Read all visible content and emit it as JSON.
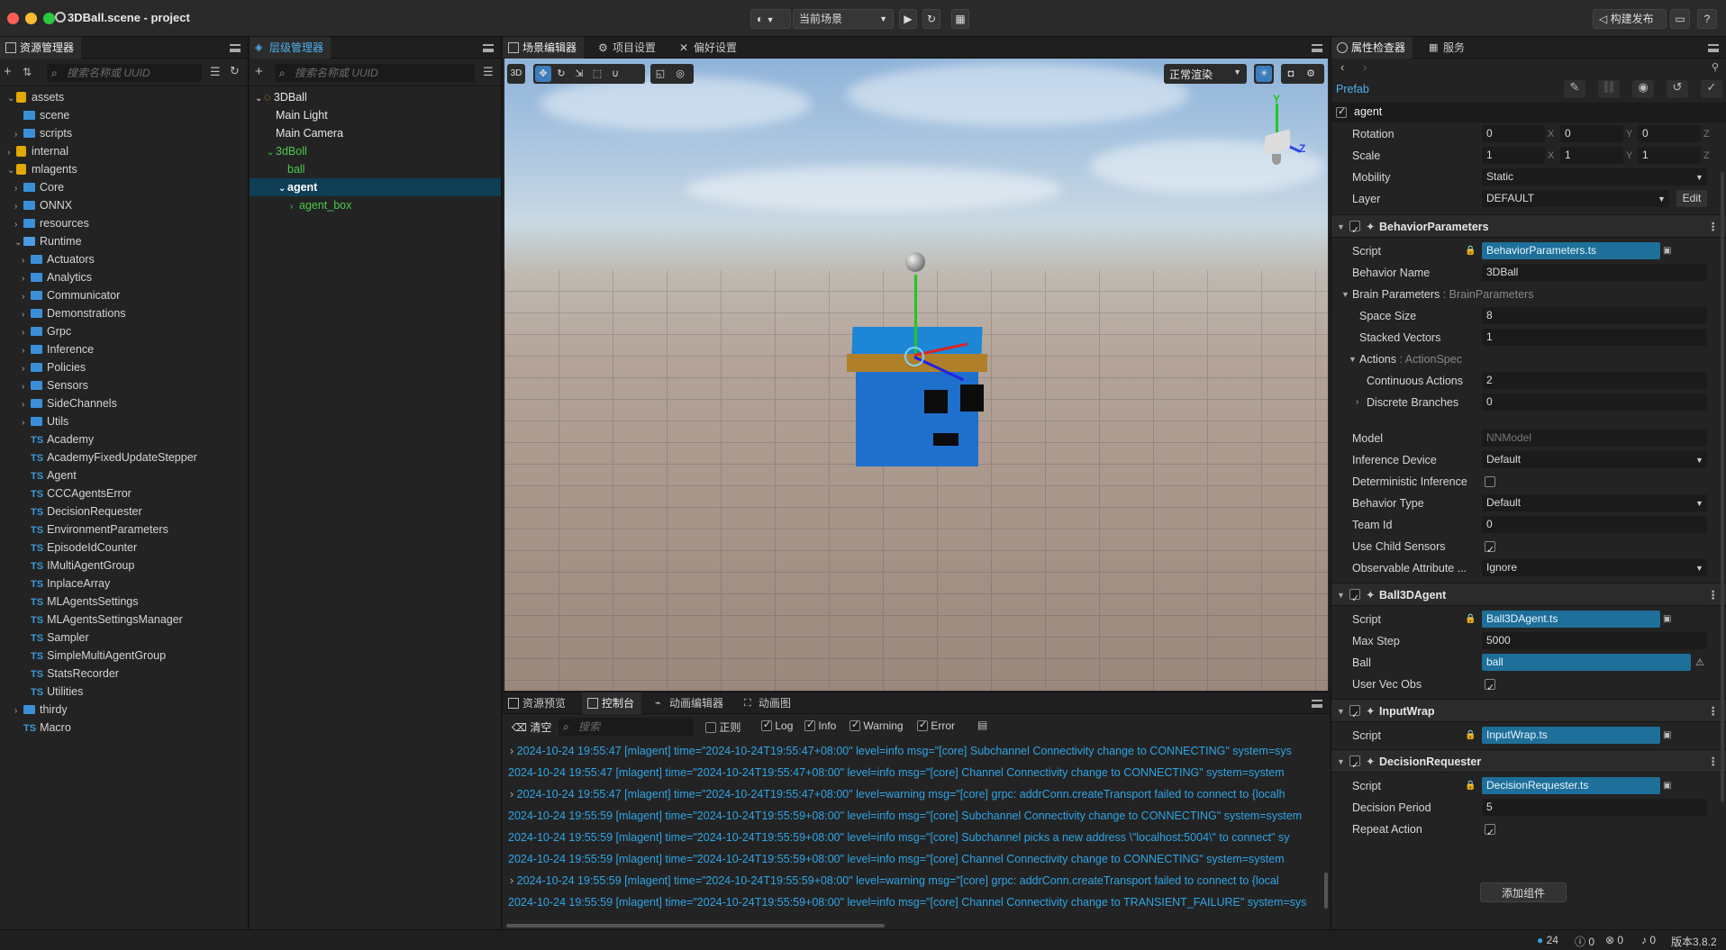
{
  "window": {
    "title": "3DBall.scene - project",
    "scene_selector": "当前场景",
    "build_button": "构建发布"
  },
  "assets_panel": {
    "tab": "资源管理器",
    "search_placeholder": "搜索名称或 UUID",
    "items": [
      {
        "label": "assets",
        "type": "db",
        "depth": 0,
        "expanded": true
      },
      {
        "label": "scene",
        "type": "folder",
        "depth": 1
      },
      {
        "label": "scripts",
        "type": "folder",
        "depth": 1,
        "collapsed": true
      },
      {
        "label": "internal",
        "type": "db",
        "depth": 0,
        "collapsed": true
      },
      {
        "label": "mlagents",
        "type": "db",
        "depth": 0,
        "expanded": true
      },
      {
        "label": "Core",
        "type": "folder",
        "depth": 1,
        "collapsed": true
      },
      {
        "label": "ONNX",
        "type": "folder",
        "depth": 1,
        "collapsed": true
      },
      {
        "label": "resources",
        "type": "folder",
        "depth": 1,
        "collapsed": true
      },
      {
        "label": "Runtime",
        "type": "folder",
        "depth": 1,
        "expanded": true
      },
      {
        "label": "Actuators",
        "type": "folder",
        "depth": 2,
        "collapsed": true
      },
      {
        "label": "Analytics",
        "type": "folder",
        "depth": 2,
        "collapsed": true
      },
      {
        "label": "Communicator",
        "type": "folder",
        "depth": 2,
        "collapsed": true
      },
      {
        "label": "Demonstrations",
        "type": "folder",
        "depth": 2,
        "collapsed": true
      },
      {
        "label": "Grpc",
        "type": "folder",
        "depth": 2,
        "collapsed": true
      },
      {
        "label": "Inference",
        "type": "folder",
        "depth": 2,
        "collapsed": true
      },
      {
        "label": "Policies",
        "type": "folder",
        "depth": 2,
        "collapsed": true
      },
      {
        "label": "Sensors",
        "type": "folder",
        "depth": 2,
        "collapsed": true
      },
      {
        "label": "SideChannels",
        "type": "folder",
        "depth": 2,
        "collapsed": true
      },
      {
        "label": "Utils",
        "type": "folder",
        "depth": 2,
        "collapsed": true
      },
      {
        "label": "Academy",
        "type": "ts",
        "depth": 2
      },
      {
        "label": "AcademyFixedUpdateStepper",
        "type": "ts",
        "depth": 2
      },
      {
        "label": "Agent",
        "type": "ts",
        "depth": 2
      },
      {
        "label": "CCCAgentsError",
        "type": "ts",
        "depth": 2
      },
      {
        "label": "DecisionRequester",
        "type": "ts",
        "depth": 2
      },
      {
        "label": "EnvironmentParameters",
        "type": "ts",
        "depth": 2
      },
      {
        "label": "EpisodeIdCounter",
        "type": "ts",
        "depth": 2
      },
      {
        "label": "IMultiAgentGroup",
        "type": "ts",
        "depth": 2
      },
      {
        "label": "InplaceArray",
        "type": "ts",
        "depth": 2
      },
      {
        "label": "MLAgentsSettings",
        "type": "ts",
        "depth": 2
      },
      {
        "label": "MLAgentsSettingsManager",
        "type": "ts",
        "depth": 2
      },
      {
        "label": "Sampler",
        "type": "ts",
        "depth": 2
      },
      {
        "label": "SimpleMultiAgentGroup",
        "type": "ts",
        "depth": 2
      },
      {
        "label": "StatsRecorder",
        "type": "ts",
        "depth": 2
      },
      {
        "label": "Utilities",
        "type": "ts",
        "depth": 2
      },
      {
        "label": "thirdy",
        "type": "folder",
        "depth": 1,
        "collapsed": true
      },
      {
        "label": "Macro",
        "type": "ts",
        "depth": 1
      }
    ]
  },
  "hierarchy_panel": {
    "tab": "层级管理器",
    "search_placeholder": "搜索名称或 UUID",
    "items": [
      {
        "label": "3DBall",
        "depth": 0,
        "color": "#e6e6e6",
        "arrow": "v",
        "icon": "scene"
      },
      {
        "label": "Main Light",
        "depth": 1,
        "color": "#e6e6e6"
      },
      {
        "label": "Main Camera",
        "depth": 1,
        "color": "#e6e6e6"
      },
      {
        "label": "3dBoll",
        "depth": 1,
        "color": "#4cc94c",
        "arrow": "v"
      },
      {
        "label": "ball",
        "depth": 2,
        "color": "#4cc94c"
      },
      {
        "label": "agent",
        "depth": 2,
        "color": "#ffffff",
        "arrow": "v",
        "selected": true
      },
      {
        "label": "agent_box",
        "depth": 3,
        "color": "#4cc94c",
        "arrow": ">"
      }
    ]
  },
  "center_tabs": {
    "scene_editor": "场景编辑器",
    "project_settings": "项目设置",
    "preferences": "偏好设置",
    "render_mode": "正常渲染",
    "mode_3d": "3D"
  },
  "bottom_tabs": {
    "asset_preview": "资源预览",
    "console": "控制台",
    "animation_editor": "动画编辑器",
    "animation_graph": "动画图"
  },
  "console": {
    "clear": "清空",
    "search_placeholder": "搜索",
    "filters": {
      "regex": "正则",
      "log": "Log",
      "info": "Info",
      "warning": "Warning",
      "error": "Error"
    },
    "lines": [
      {
        "text": "2024-10-24 19:55:47 [mlagent] time=\"2024-10-24T19:55:47+08:00\" level=info msg=\"[core] Subchannel Connectivity change to CONNECTING\" system=sys",
        "expand": true
      },
      {
        "text": "2024-10-24 19:55:47 [mlagent] time=\"2024-10-24T19:55:47+08:00\" level=info msg=\"[core] Channel Connectivity change to CONNECTING\" system=system",
        "expand": false
      },
      {
        "text": "2024-10-24 19:55:47 [mlagent] time=\"2024-10-24T19:55:47+08:00\" level=warning msg=\"[core] grpc: addrConn.createTransport failed to connect to {localh",
        "expand": true
      },
      {
        "text": "2024-10-24 19:55:59 [mlagent] time=\"2024-10-24T19:55:59+08:00\" level=info msg=\"[core] Subchannel Connectivity change to CONNECTING\" system=system",
        "expand": false
      },
      {
        "text": "2024-10-24 19:55:59 [mlagent] time=\"2024-10-24T19:55:59+08:00\" level=info msg=\"[core] Subchannel picks a new address \\\"localhost:5004\\\" to connect\" sy",
        "expand": false
      },
      {
        "text": "2024-10-24 19:55:59 [mlagent] time=\"2024-10-24T19:55:59+08:00\" level=info msg=\"[core] Channel Connectivity change to CONNECTING\" system=system",
        "expand": false
      },
      {
        "text": "2024-10-24 19:55:59 [mlagent] time=\"2024-10-24T19:55:59+08:00\" level=warning msg=\"[core] grpc: addrConn.createTransport failed to connect to {local",
        "expand": true
      },
      {
        "text": "2024-10-24 19:55:59 [mlagent] time=\"2024-10-24T19:55:59+08:00\" level=info msg=\"[core] Channel Connectivity change to TRANSIENT_FAILURE\" system=sys",
        "expand": false
      }
    ]
  },
  "inspector": {
    "tab": "属性检查器",
    "services_tab": "服务",
    "prefab_label": "Prefab",
    "node_name": "agent",
    "transform": {
      "rotation_label": "Rotation",
      "rotation": [
        "0",
        "0",
        "0"
      ],
      "scale_label": "Scale",
      "scale": [
        "1",
        "1",
        "1"
      ],
      "axes": [
        "X",
        "Y",
        "Z"
      ],
      "mobility_label": "Mobility",
      "mobility": "Static",
      "layer_label": "Layer",
      "layer": "DEFAULT",
      "edit": "Edit"
    },
    "behavior_parameters": {
      "title": "BehaviorParameters",
      "script_label": "Script",
      "script": "BehaviorParameters.ts",
      "behavior_name_label": "Behavior Name",
      "behavior_name": "3DBall",
      "brain_label": "Brain Parameters",
      "brain_type": " : BrainParameters",
      "space_size_label": "Space Size",
      "space_size": "8",
      "stacked_label": "Stacked Vectors",
      "stacked": "1",
      "actions_label": "Actions",
      "actions_type": " : ActionSpec",
      "continuous_label": "Continuous Actions",
      "continuous": "2",
      "discrete_label": "Discrete Branches",
      "discrete": "0",
      "model_label": "Model",
      "model": "NNModel",
      "inference_label": "Inference Device",
      "inference": "Default",
      "deterministic_label": "Deterministic Inference",
      "behavior_type_label": "Behavior Type",
      "behavior_type": "Default",
      "team_label": "Team Id",
      "team": "0",
      "child_sensors_label": "Use Child Sensors",
      "observable_label": "Observable Attribute ...",
      "observable": "Ignore"
    },
    "ball3d": {
      "title": "Ball3DAgent",
      "script_label": "Script",
      "script": "Ball3DAgent.ts",
      "max_step_label": "Max Step",
      "max_step": "5000",
      "ball_label": "Ball",
      "ball": "ball",
      "vec_obs_label": "User Vec Obs"
    },
    "inputwrap": {
      "title": "InputWrap",
      "script_label": "Script",
      "script": "InputWrap.ts"
    },
    "decision": {
      "title": "DecisionRequester",
      "script_label": "Script",
      "script": "DecisionRequester.ts",
      "period_label": "Decision Period",
      "period": "5",
      "repeat_label": "Repeat Action"
    },
    "add_component": "添加组件"
  },
  "status": {
    "info_count": "24",
    "warn_count": "0",
    "error_count": "0",
    "notify_count": "0",
    "version": "版本3.8.2"
  }
}
